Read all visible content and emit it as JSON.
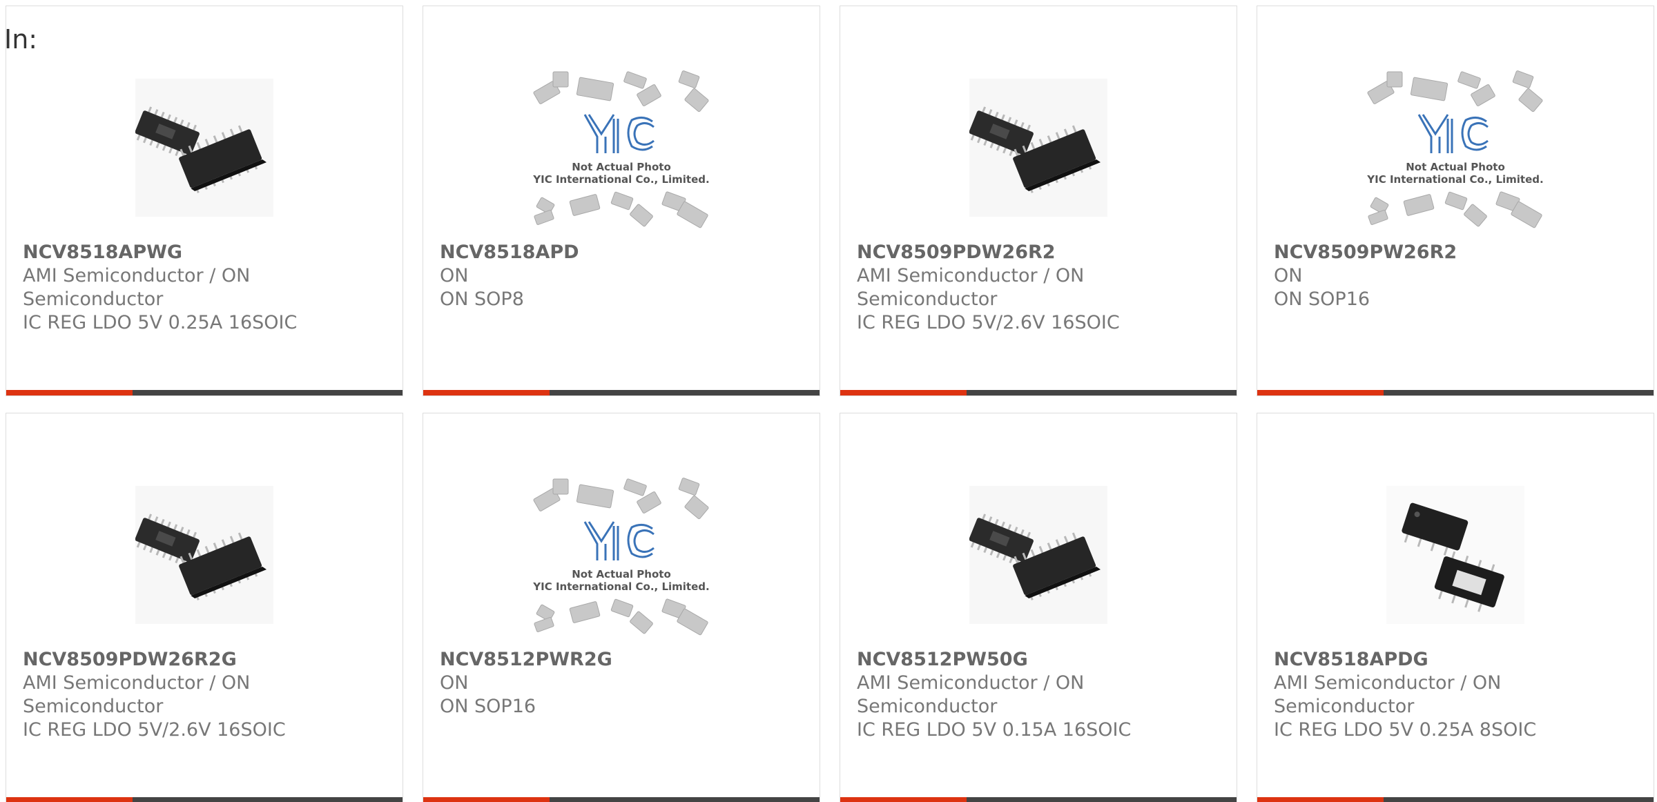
{
  "page": {
    "filter_label": "In:"
  },
  "colors": {
    "accent": "#dd3311",
    "bar": "#444444",
    "text": "#777777",
    "yic_logo": "#3a73b8"
  },
  "products": [
    {
      "part_number": "NCV8518APWG",
      "manufacturer_line1": "AMI Semiconductor / ON",
      "manufacturer_line2": "Semiconductor",
      "description": "IC REG LDO 5V 0.25A 16SOIC",
      "image": "tssop-chip-photo"
    },
    {
      "part_number": "NCV8518APD",
      "manufacturer_line1": "ON",
      "manufacturer_line2": "",
      "description": "ON SOP8",
      "image": "yic-placeholder",
      "placeholder_line1": "Not Actual Photo",
      "placeholder_line2": "YIC International Co., Limited."
    },
    {
      "part_number": "NCV8509PDW26R2",
      "manufacturer_line1": "AMI Semiconductor / ON",
      "manufacturer_line2": "Semiconductor",
      "description": "IC REG LDO 5V/2.6V 16SOIC",
      "image": "tssop-chip-photo"
    },
    {
      "part_number": "NCV8509PW26R2",
      "manufacturer_line1": "ON",
      "manufacturer_line2": "",
      "description": "ON SOP16",
      "image": "yic-placeholder",
      "placeholder_line1": "Not Actual Photo",
      "placeholder_line2": "YIC International Co., Limited."
    },
    {
      "part_number": "NCV8509PDW26R2G",
      "manufacturer_line1": "AMI Semiconductor / ON",
      "manufacturer_line2": "Semiconductor",
      "description": "IC REG LDO 5V/2.6V 16SOIC",
      "image": "tssop-chip-photo"
    },
    {
      "part_number": "NCV8512PWR2G",
      "manufacturer_line1": "ON",
      "manufacturer_line2": "",
      "description": "ON SOP16",
      "image": "yic-placeholder",
      "placeholder_line1": "Not Actual Photo",
      "placeholder_line2": "YIC International Co., Limited."
    },
    {
      "part_number": "NCV8512PW50G",
      "manufacturer_line1": "AMI Semiconductor / ON",
      "manufacturer_line2": "Semiconductor",
      "description": "IC REG LDO 5V 0.15A 16SOIC",
      "image": "tssop-chip-photo"
    },
    {
      "part_number": "NCV8518APDG",
      "manufacturer_line1": "AMI Semiconductor / ON",
      "manufacturer_line2": "Semiconductor",
      "description": "IC REG LDO 5V 0.25A 8SOIC",
      "image": "soic8-chip-photo"
    }
  ]
}
